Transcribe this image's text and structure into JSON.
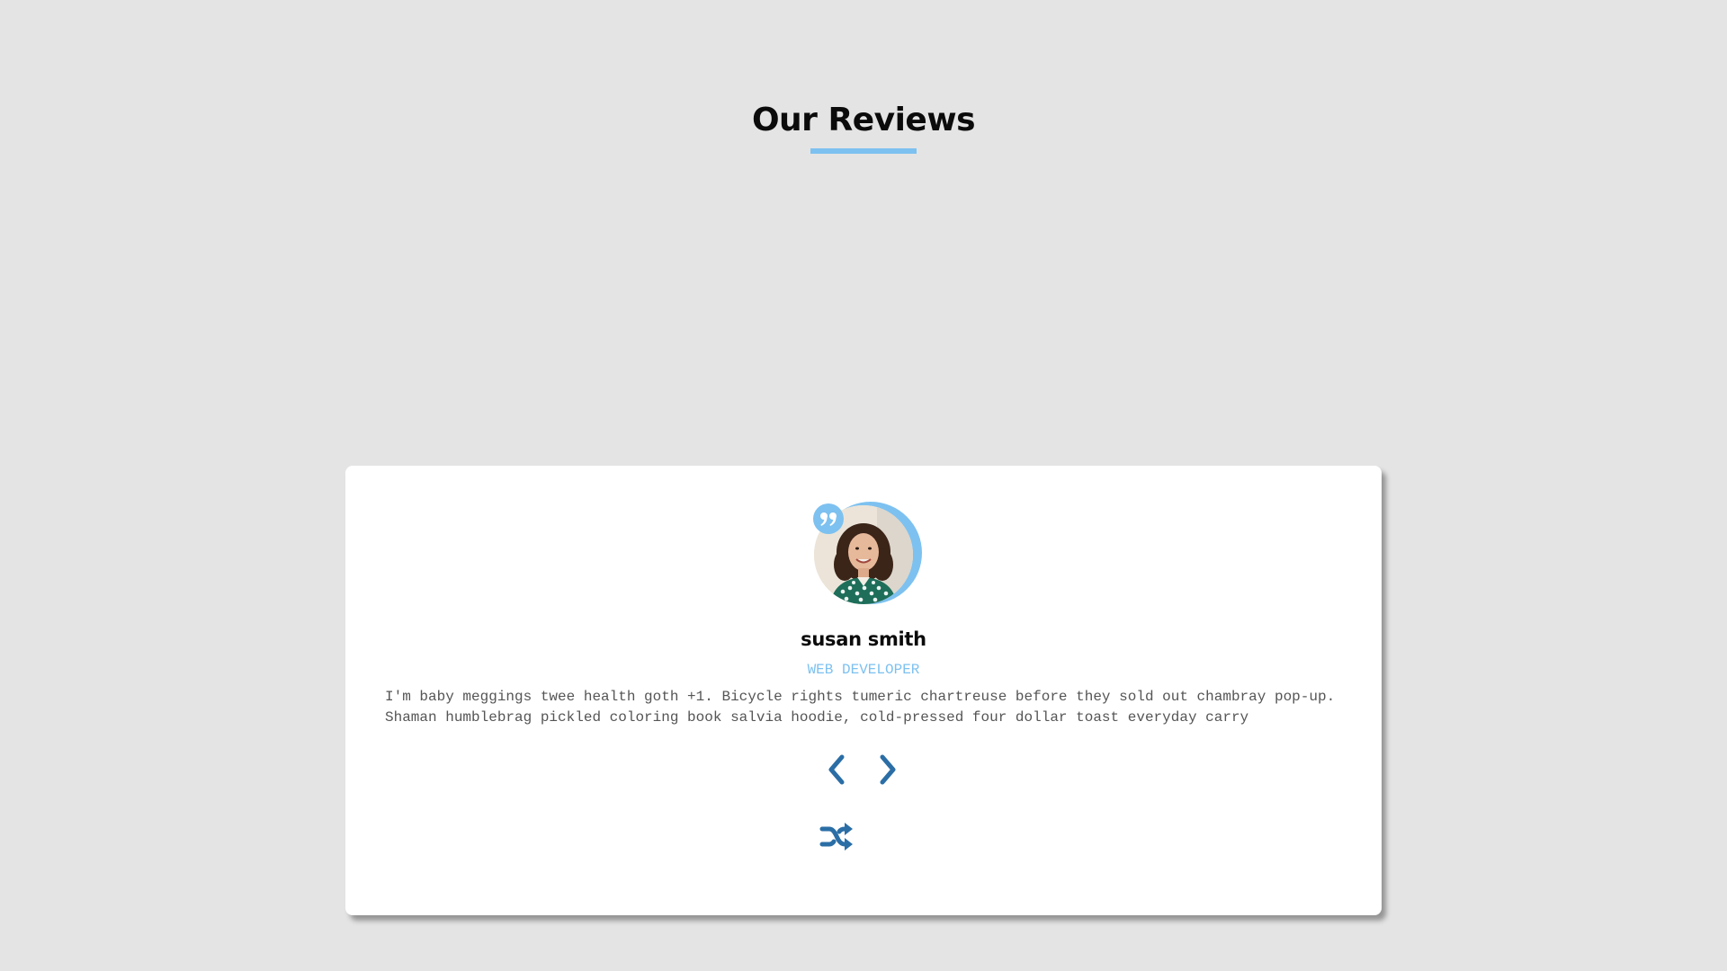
{
  "section": {
    "title": "Our Reviews",
    "underline_color": "#7dc1f0"
  },
  "review": {
    "name": "susan smith",
    "job": "web developer",
    "text": "I'm baby meggings twee health goth +1. Bicycle rights tumeric chartreuse before they sold out chambray pop-up. Shaman humblebrag pickled coloring book salvia hoodie, cold-pressed four dollar toast everyday carry",
    "avatar_icon": "person-photo",
    "quote_icon": "quote-right-icon"
  },
  "controls": {
    "prev_icon": "chevron-left-icon",
    "next_icon": "chevron-right-icon",
    "random_icon": "shuffle-icon"
  },
  "colors": {
    "background": "#e4e4e4",
    "accent": "#7dc1f0",
    "button": "#2b6ea6",
    "card": "#ffffff"
  }
}
